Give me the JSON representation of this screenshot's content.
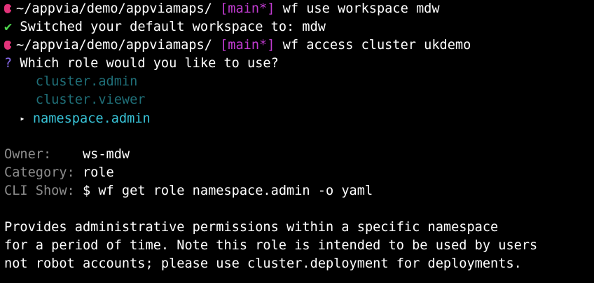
{
  "prompt_path": "~/appvia/demo/appviamaps/",
  "branch": "[main*]",
  "commands": [
    "wf use workspace mdw",
    "wf access cluster ukdemo"
  ],
  "success_mark": "✔",
  "success_message": "Switched your default workspace to: mdw",
  "question_mark": "?",
  "question": "Which role would you like to use?",
  "options": [
    {
      "label": "cluster.admin",
      "selected": false
    },
    {
      "label": "cluster.viewer",
      "selected": false
    },
    {
      "label": "namespace.admin",
      "selected": true
    }
  ],
  "selector_glyph": "▸",
  "details": {
    "owner_label": "Owner:",
    "owner_value": "ws-mdw",
    "category_label": "Category:",
    "category_value": "role",
    "cli_label": "CLI Show:",
    "cli_value": "$ wf get role namespace.admin -o yaml"
  },
  "description": [
    "Provides administrative permissions within a specific namespace",
    "for a period of time. Note this role is intended to be used by users",
    "not robot accounts; please use cluster.deployment for deployments."
  ],
  "colors": {
    "background": "#000000",
    "prompt_icon": "#e3337a",
    "branch": "#c03bd0",
    "success": "#4fd84f",
    "question": "#8a6bf0",
    "option_dim": "#1f6f78",
    "option_selected": "#38c4d8",
    "label_gray": "#8d8d8d"
  }
}
